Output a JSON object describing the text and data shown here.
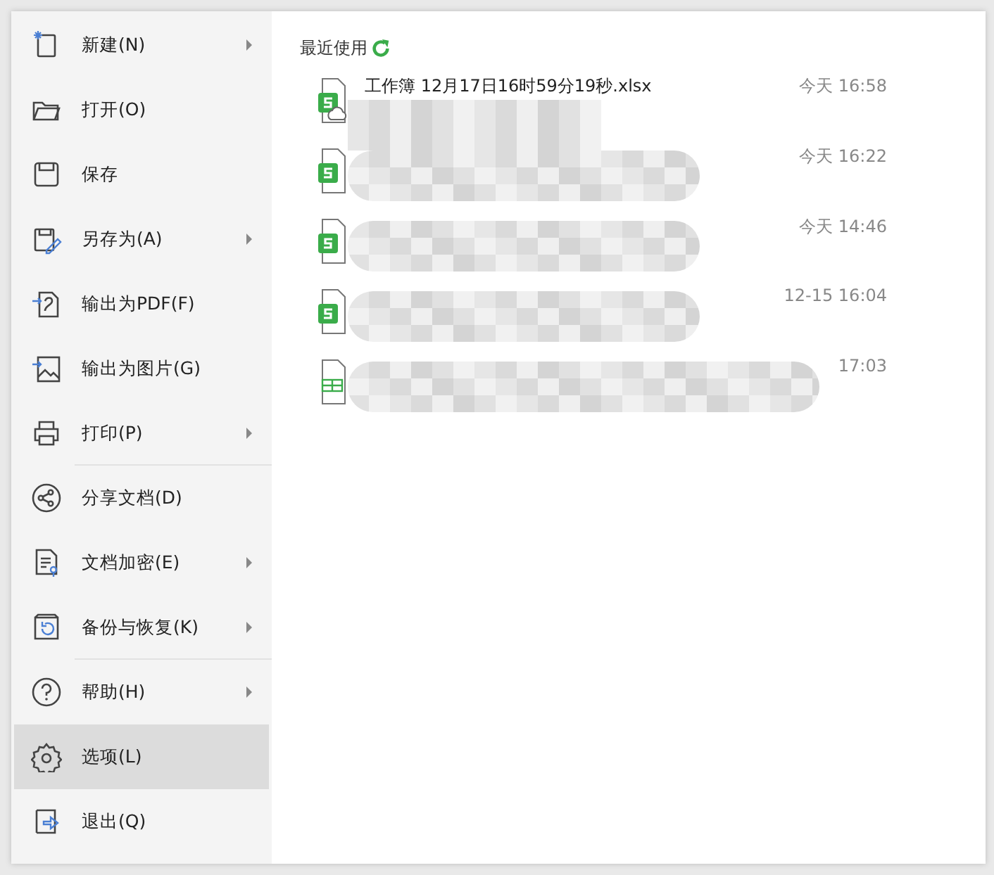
{
  "menu": {
    "items": [
      {
        "label": "新建(N)",
        "submenu": true,
        "selected": false,
        "separator_after": false
      },
      {
        "label": "打开(O)",
        "submenu": false,
        "selected": false,
        "separator_after": false
      },
      {
        "label": "保存",
        "submenu": false,
        "selected": false,
        "separator_after": false
      },
      {
        "label": "另存为(A)",
        "submenu": true,
        "selected": false,
        "separator_after": false
      },
      {
        "label": "输出为PDF(F)",
        "submenu": false,
        "selected": false,
        "separator_after": false
      },
      {
        "label": "输出为图片(G)",
        "submenu": false,
        "selected": false,
        "separator_after": false
      },
      {
        "label": "打印(P)",
        "submenu": true,
        "selected": false,
        "separator_after": true
      },
      {
        "label": "分享文档(D)",
        "submenu": false,
        "selected": false,
        "separator_after": false
      },
      {
        "label": "文档加密(E)",
        "submenu": true,
        "selected": false,
        "separator_after": false
      },
      {
        "label": "备份与恢复(K)",
        "submenu": true,
        "selected": false,
        "separator_after": true
      },
      {
        "label": "帮助(H)",
        "submenu": true,
        "selected": false,
        "separator_after": false
      },
      {
        "label": "选项(L)",
        "submenu": false,
        "selected": true,
        "separator_after": false
      },
      {
        "label": "退出(Q)",
        "submenu": false,
        "selected": false,
        "separator_after": false
      }
    ]
  },
  "recent": {
    "title": "最近使用",
    "files": [
      {
        "kind": "sheet",
        "cloud": true,
        "name": "工作簿 12月17日16时59分19秒.xlsx",
        "time": "今天 16:58"
      },
      {
        "kind": "sheet",
        "cloud": false,
        "time": "今天 16:22"
      },
      {
        "kind": "sheet",
        "cloud": false,
        "time": "今天 14:46"
      },
      {
        "kind": "sheet",
        "cloud": false,
        "time": "12-15 16:04"
      },
      {
        "kind": "table",
        "cloud": false,
        "time": "17:03"
      }
    ]
  }
}
